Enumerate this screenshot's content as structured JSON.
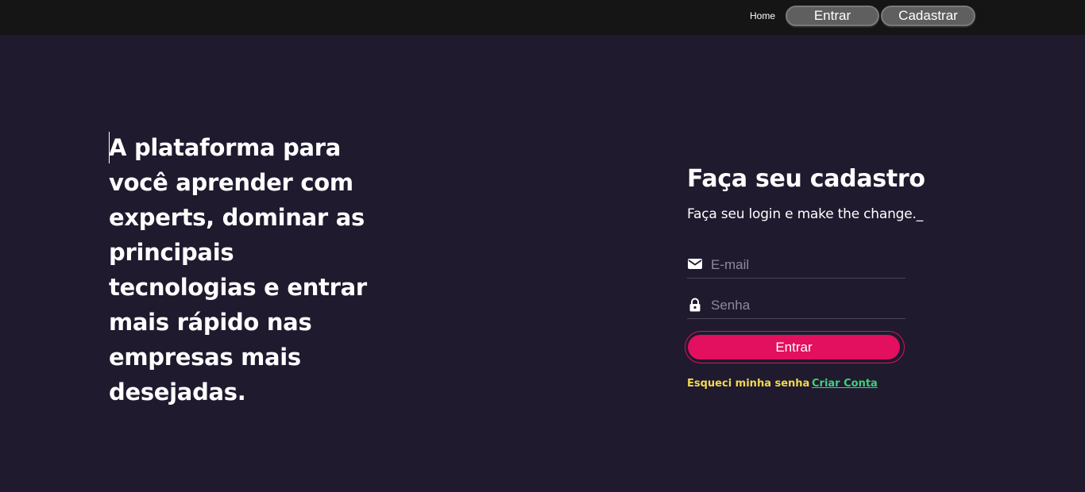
{
  "nav": {
    "home_label": "Home",
    "login_label": "Entrar",
    "signup_label": "Cadastrar"
  },
  "hero": {
    "headline": "A plataforma para você aprender com experts, dominar as principais tecnologias e entrar mais rápido nas empresas mais desejadas."
  },
  "form": {
    "title": "Faça seu cadastro",
    "subtitle": "Faça seu login e make the change._",
    "email_placeholder": "E-mail",
    "email_icon": "mail-icon",
    "password_placeholder": "Senha",
    "password_icon": "lock-icon",
    "submit_label": "Entrar",
    "forgot_label": "Esqueci minha senha",
    "create_label": "Criar Conta"
  },
  "colors": {
    "background": "#1f1a2e",
    "topbar": "#151515",
    "accent": "#e2105e",
    "forgot_link": "#f2d94e",
    "create_link": "#3ed17a"
  }
}
